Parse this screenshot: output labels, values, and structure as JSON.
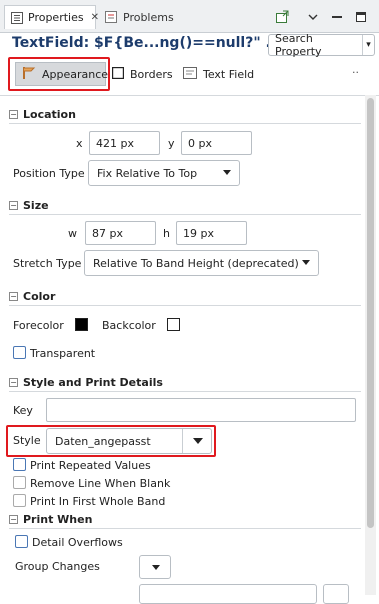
{
  "tabs": {
    "properties_label": "Properties",
    "problems_label": "Problems",
    "close_glyph": "✕"
  },
  "header": {
    "title": "TextField: $F{Be...ng()==null?\" ...",
    "search_label": "Search Property"
  },
  "subtabs": {
    "appearance": "Appearance",
    "borders": "Borders",
    "text_field": "Text Field",
    "more": "··"
  },
  "location": {
    "heading": "Location",
    "x_label": "x",
    "x_value": "421 px",
    "y_label": "y",
    "y_value": "0 px",
    "position_type_label": "Position Type",
    "position_type_value": "Fix Relative To Top"
  },
  "size": {
    "heading": "Size",
    "w_label": "w",
    "w_value": "87 px",
    "h_label": "h",
    "h_value": "19 px",
    "stretch_type_label": "Stretch Type",
    "stretch_type_value": "Relative To Band Height (deprecated)"
  },
  "color": {
    "heading": "Color",
    "forecolor_label": "Forecolor",
    "forecolor": "#000000",
    "backcolor_label": "Backcolor",
    "backcolor": "#ffffff",
    "transparent_label": "Transparent"
  },
  "style_print": {
    "heading": "Style and Print Details",
    "key_label": "Key",
    "key_value": "",
    "style_label": "Style",
    "style_value": "Daten_angepasst",
    "print_repeated_label": "Print Repeated Values",
    "remove_line_label": "Remove Line When Blank",
    "print_first_label": "Print In First Whole Band"
  },
  "print_when": {
    "heading": "Print When",
    "detail_overflows_label": "Detail Overflows",
    "group_changes_label": "Group Changes"
  },
  "colors": {
    "highlight_red": "#e0191e",
    "title_blue": "#1d3c6c"
  }
}
